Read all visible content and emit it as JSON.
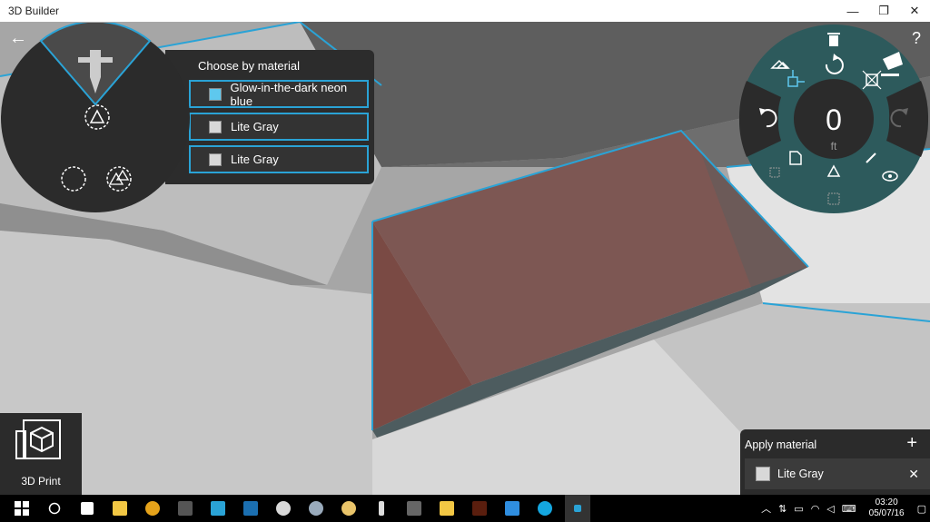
{
  "window": {
    "title": "3D Builder",
    "minimize": "—",
    "restore": "❐",
    "close": "✕"
  },
  "nav": {
    "back": "←",
    "help": "?"
  },
  "material_panel": {
    "title": "Choose by material",
    "items": [
      {
        "label": "Glow-in-the-dark neon blue",
        "swatch": "#5ec8ee"
      },
      {
        "label": "Lite Gray",
        "swatch": "#d8d8d8"
      },
      {
        "label": "Lite Gray",
        "swatch": "#d8d8d8"
      }
    ]
  },
  "measure": {
    "value": "0",
    "unit": "ft"
  },
  "print": {
    "label": "3D Print"
  },
  "apply_panel": {
    "title": "Apply material",
    "add": "+",
    "item_label": "Lite Gray",
    "remove": "✕"
  },
  "taskbar": {
    "icons": [
      {
        "name": "start",
        "color": "#ffffff"
      },
      {
        "name": "cortana",
        "color": "#ffffff"
      },
      {
        "name": "store",
        "color": "#ffffff"
      },
      {
        "name": "file-explorer",
        "color": "#f2c744"
      },
      {
        "name": "chrome",
        "color": "#e5a21a"
      },
      {
        "name": "app-dark",
        "color": "#555555"
      },
      {
        "name": "app-s",
        "color": "#2aa3d6"
      },
      {
        "name": "app-f",
        "color": "#1b6fb0"
      },
      {
        "name": "app-round",
        "color": "#d9d9d9"
      },
      {
        "name": "steam",
        "color": "#9ab"
      },
      {
        "name": "paint",
        "color": "#e9c46a"
      },
      {
        "name": "chess",
        "color": "#dddddd"
      },
      {
        "name": "app-grey",
        "color": "#666666"
      },
      {
        "name": "app-yellow",
        "color": "#f2c744"
      },
      {
        "name": "illustrator",
        "color": "#5a1e0e"
      },
      {
        "name": "dropbox",
        "color": "#2f8ee0"
      },
      {
        "name": "skype",
        "color": "#14a7e0"
      },
      {
        "name": "3d-builder",
        "color": "#333333"
      }
    ],
    "clock": {
      "time": "03:20",
      "date": "05/07/16"
    }
  }
}
